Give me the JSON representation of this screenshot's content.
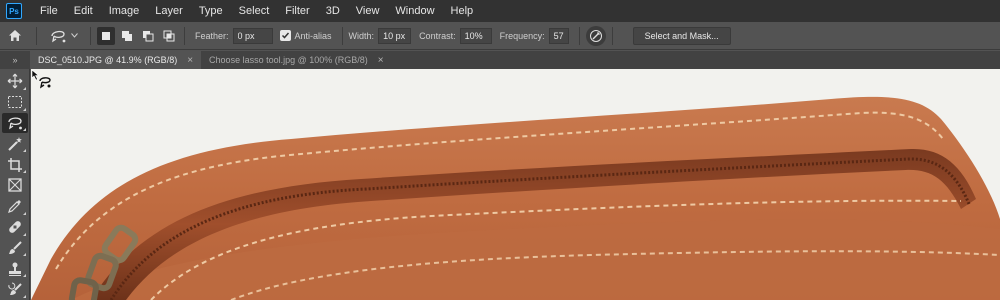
{
  "app": {
    "logo": "Ps"
  },
  "menu": [
    "File",
    "Edit",
    "Image",
    "Layer",
    "Type",
    "Select",
    "Filter",
    "3D",
    "View",
    "Window",
    "Help"
  ],
  "options": {
    "feather_label": "Feather:",
    "feather_value": "0 px",
    "antialias_label": "Anti-alias",
    "antialias_checked": true,
    "width_label": "Width:",
    "width_value": "10 px",
    "contrast_label": "Contrast:",
    "contrast_value": "10%",
    "frequency_label": "Frequency:",
    "frequency_value": "57",
    "select_mask_label": "Select and Mask..."
  },
  "tabs": [
    {
      "label": "DSC_0510.JPG @ 41.9% (RGB/8)",
      "active": true
    },
    {
      "label": "Choose lasso tool.jpg @ 100% (RGB/8)",
      "active": false
    }
  ],
  "toolbar_toggle": "»",
  "tools": [
    "move-icon",
    "marquee-icon",
    "magnetic-lasso-icon",
    "magic-wand-icon",
    "crop-icon",
    "frame-icon",
    "eyedropper-icon",
    "healing-brush-icon",
    "brush-icon",
    "clone-stamp-icon",
    "history-brush-icon"
  ],
  "close_glyph": "×",
  "colors": {
    "leather": "#c8754a",
    "leather_dark": "#9c5334",
    "stitch": "#eec9a3",
    "canvas_bg": "#f2f2ee"
  }
}
